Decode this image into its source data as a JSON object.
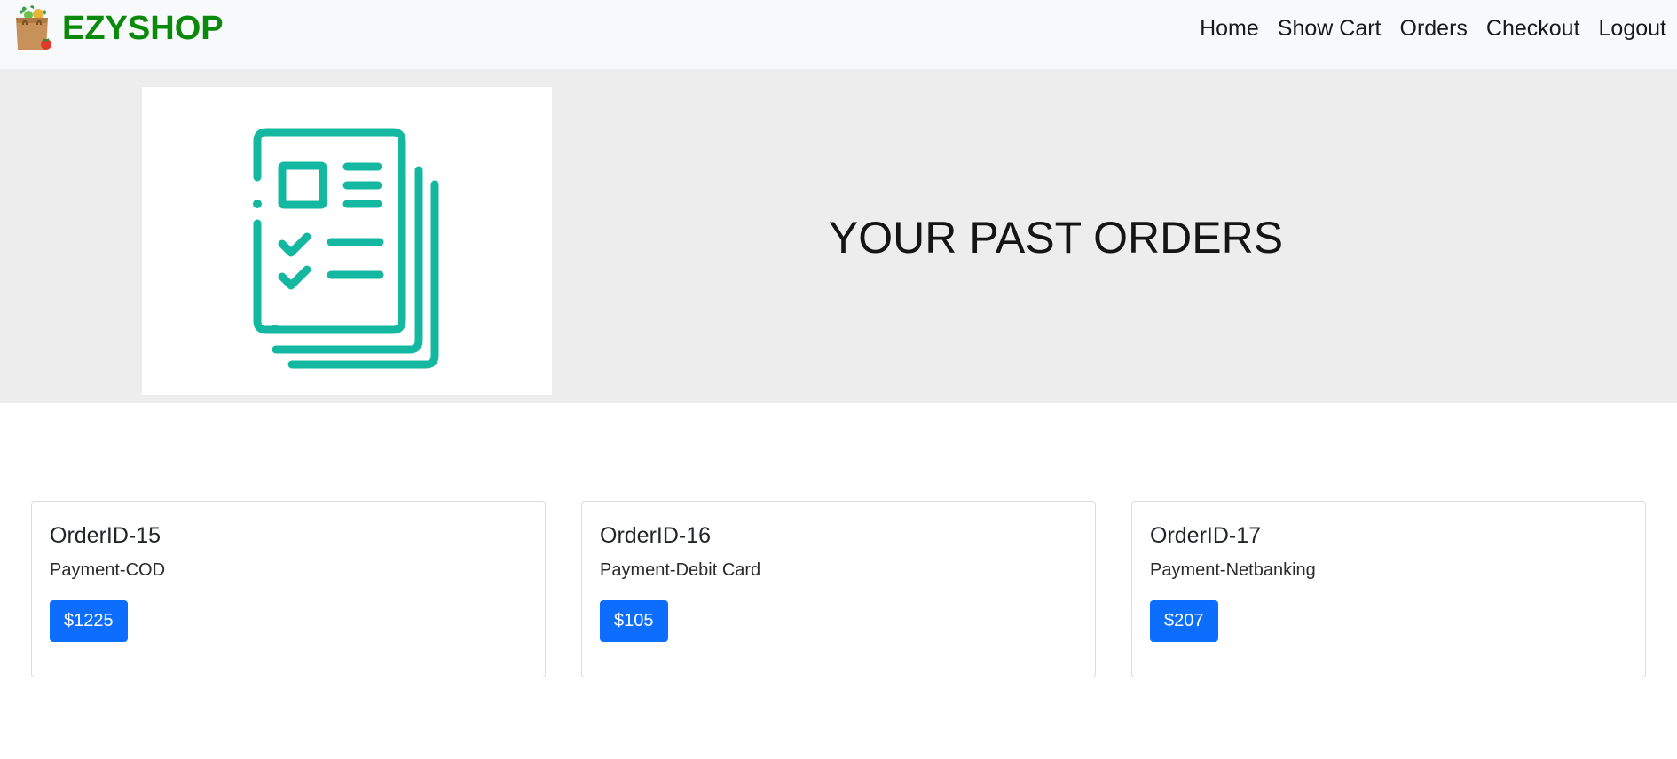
{
  "brand": {
    "name": "EZYSHOP",
    "color": "#0a8a0a"
  },
  "nav": {
    "items": [
      {
        "label": "Home"
      },
      {
        "label": "Show Cart"
      },
      {
        "label": "Orders"
      },
      {
        "label": "Checkout"
      },
      {
        "label": "Logout"
      }
    ]
  },
  "hero": {
    "title": "YOUR PAST ORDERS",
    "image_icon": "order-list-icon",
    "icon_color": "#14b8a0"
  },
  "orders": [
    {
      "title": "OrderID-15",
      "payment": "Payment-COD",
      "amount": "$1225"
    },
    {
      "title": "OrderID-16",
      "payment": "Payment-Debit Card",
      "amount": "$105"
    },
    {
      "title": "OrderID-17",
      "payment": "Payment-Netbanking",
      "amount": "$207"
    }
  ],
  "colors": {
    "navbar_bg": "#f8f9fa",
    "hero_bg": "#ededed",
    "amount_button": "#0d6efd"
  }
}
